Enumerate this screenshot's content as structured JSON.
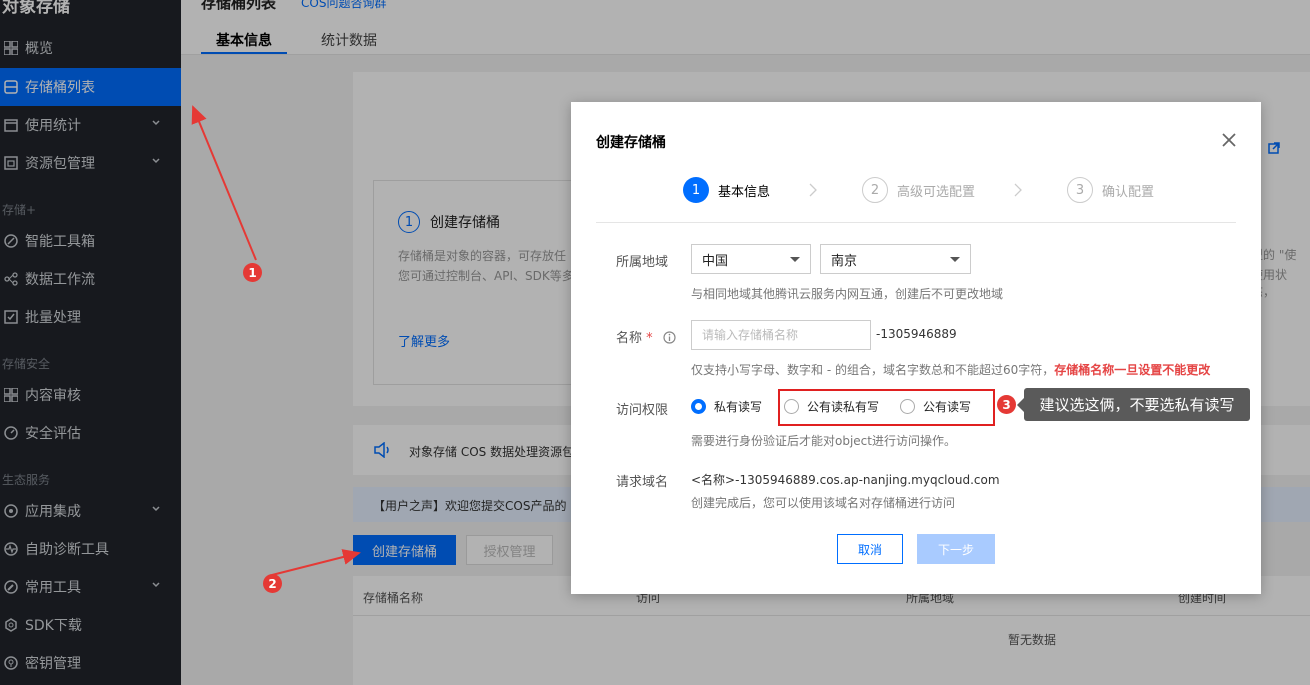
{
  "sidebar": {
    "title": "对象存储",
    "items": [
      {
        "label": "概览"
      },
      {
        "label": "存储桶列表"
      },
      {
        "label": "使用统计"
      },
      {
        "label": "资源包管理"
      },
      {
        "label": "智能工具箱"
      },
      {
        "label": "数据工作流"
      },
      {
        "label": "批量处理"
      },
      {
        "label": "内容审核"
      },
      {
        "label": "安全评估"
      },
      {
        "label": "应用集成"
      },
      {
        "label": "自助诊断工具"
      },
      {
        "label": "常用工具"
      },
      {
        "label": "SDK下载"
      },
      {
        "label": "密钥管理"
      }
    ],
    "sections": [
      "存储+",
      "存储安全",
      "生态服务"
    ]
  },
  "header": {
    "title": "存储桶列表",
    "faq_link": "COS问题咨询群",
    "tabs": [
      "基本信息",
      "统计数据"
    ]
  },
  "background": {
    "step_card": {
      "num": "1",
      "title": "创建存储桶",
      "desc1": "存储桶是对象的容器，可存放任",
      "desc2": "您可通过控制台、API、SDK等多",
      "learn_more": "了解更多"
    },
    "right_snippet1": "型的 \"使",
    "right_snippet2": "使用状态，",
    "notice": "对象存储 COS 数据处理资源包",
    "user_voice": "【用户之声】欢迎您提交COS产品的",
    "create_btn": "创建存储桶",
    "auth_btn": "授权管理",
    "table": {
      "columns": [
        "存储桶名称",
        "访问",
        "所属地域",
        "创建时间"
      ],
      "empty": "暂无数据"
    }
  },
  "dialog": {
    "title": "创建存储桶",
    "steps": [
      {
        "num": "1",
        "label": "基本信息"
      },
      {
        "num": "2",
        "label": "高级可选配置"
      },
      {
        "num": "3",
        "label": "确认配置"
      }
    ],
    "region": {
      "label": "所属地域",
      "country": "中国",
      "city": "南京",
      "hint": "与相同地域其他腾讯云服务内网互通，创建后不可更改地域"
    },
    "name": {
      "label": "名称",
      "required_mark": "*",
      "placeholder": "请输入存储桶名称",
      "suffix": "-1305946889",
      "hint": "仅支持小写字母、数字和 - 的组合，域名字数总和不能超过60字符，",
      "warning": "存储桶名称一旦设置不能更改"
    },
    "access": {
      "label": "访问权限",
      "options": [
        "私有读写",
        "公有读私有写",
        "公有读写"
      ],
      "selected": "私有读写",
      "hint": "需要进行身份验证后才能对object进行访问操作。"
    },
    "domain": {
      "label": "请求域名",
      "value": "<名称>-1305946889.cos.ap-nanjing.myqcloud.com",
      "hint": "创建完成后，您可以使用该域名对存储桶进行访问"
    },
    "cancel": "取消",
    "next": "下一步"
  },
  "annotations": {
    "badge1": "1",
    "badge2": "2",
    "badge3": "3",
    "tooltip": "建议选这俩，不要选私有读写"
  },
  "colors": {
    "accent": "#006eff",
    "sidebar_bg": "#21252b",
    "annotation_red": "#e53935",
    "tooltip_bg": "#5a5a5a"
  }
}
